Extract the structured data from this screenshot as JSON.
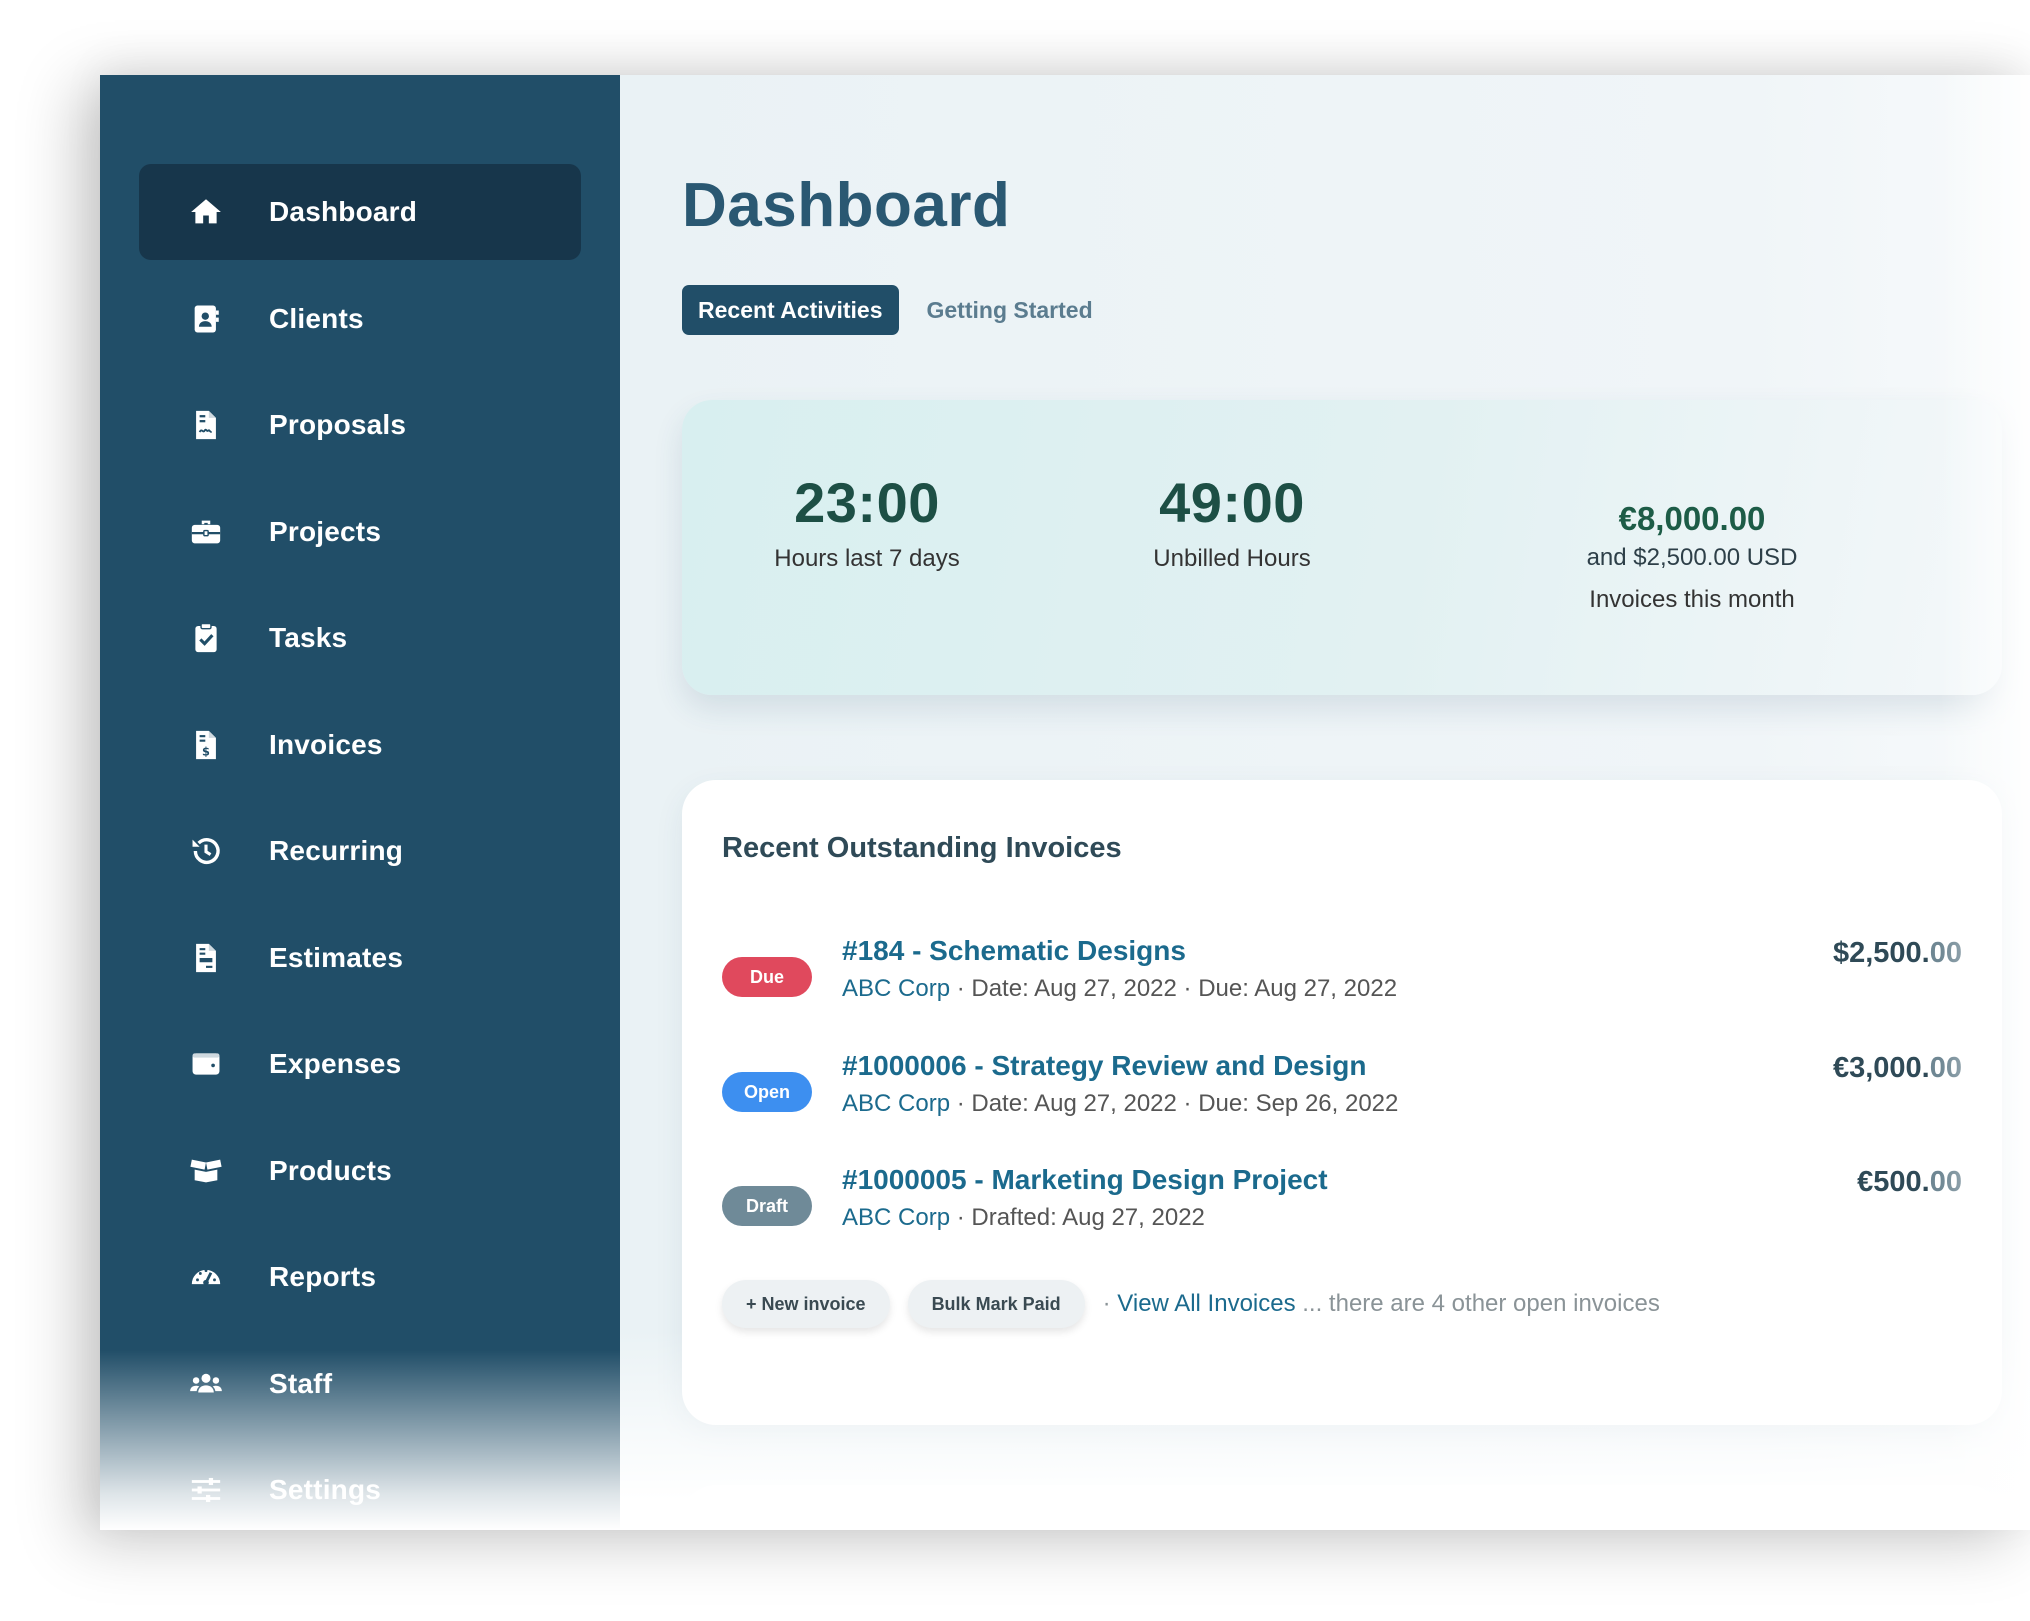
{
  "sidebar": {
    "items": [
      {
        "label": "Dashboard",
        "icon": "home-icon",
        "active": true
      },
      {
        "label": "Clients",
        "icon": "contact-card-icon"
      },
      {
        "label": "Proposals",
        "icon": "signed-document-icon"
      },
      {
        "label": "Projects",
        "icon": "briefcase-icon"
      },
      {
        "label": "Tasks",
        "icon": "clipboard-check-icon"
      },
      {
        "label": "Invoices",
        "icon": "invoice-dollar-icon"
      },
      {
        "label": "Recurring",
        "icon": "history-icon"
      },
      {
        "label": "Estimates",
        "icon": "estimate-document-icon"
      },
      {
        "label": "Expenses",
        "icon": "wallet-icon"
      },
      {
        "label": "Products",
        "icon": "box-open-icon"
      },
      {
        "label": "Reports",
        "icon": "gauge-icon"
      },
      {
        "label": "Staff",
        "icon": "users-icon"
      },
      {
        "label": "Settings",
        "icon": "sliders-icon"
      }
    ]
  },
  "header": {
    "title": "Dashboard",
    "tabs": [
      {
        "label": "Recent Activities",
        "active": true
      },
      {
        "label": "Getting Started",
        "active": false
      }
    ]
  },
  "stats": {
    "hours_last_7_days": {
      "value": "23:00",
      "label": "Hours last 7 days"
    },
    "unbilled_hours": {
      "value": "49:00",
      "label": "Unbilled Hours"
    },
    "invoices_this_month": {
      "value": "€8,000.00",
      "secondary": "and $2,500.00 USD",
      "label": "Invoices this month"
    }
  },
  "outstanding": {
    "title": "Recent Outstanding Invoices",
    "invoices": [
      {
        "status": "Due",
        "status_color": "#e0495d",
        "title": "#184 - Schematic Designs",
        "client": "ABC Corp",
        "meta": " · Date: Aug 27, 2022 · Due: Aug 27, 2022",
        "amount_main": "$2,500.",
        "amount_cents": "00"
      },
      {
        "status": "Open",
        "status_color": "#3d8ff0",
        "title": "#1000006 - Strategy Review and Design",
        "client": "ABC Corp",
        "meta": " · Date: Aug 27, 2022 · Due: Sep 26, 2022",
        "amount_main": "€3,000.",
        "amount_cents": "00"
      },
      {
        "status": "Draft",
        "status_color": "#6f8a98",
        "title": "#1000005 - Marketing Design Project",
        "client": "ABC Corp",
        "meta": " · Drafted: Aug 27, 2022",
        "amount_main": "€500.",
        "amount_cents": "00"
      }
    ],
    "new_invoice_label": "+ New invoice",
    "bulk_mark_paid_label": "Bulk Mark Paid",
    "separator": "· ",
    "view_all_label": "View All Invoices",
    "other_note": " ... there are 4 other open invoices"
  },
  "colors": {
    "sidebar_bg": "#214e68",
    "sidebar_active": "#17364b",
    "title": "#2a5872",
    "link": "#1b6a8d",
    "stat_value": "#1d4f45"
  }
}
